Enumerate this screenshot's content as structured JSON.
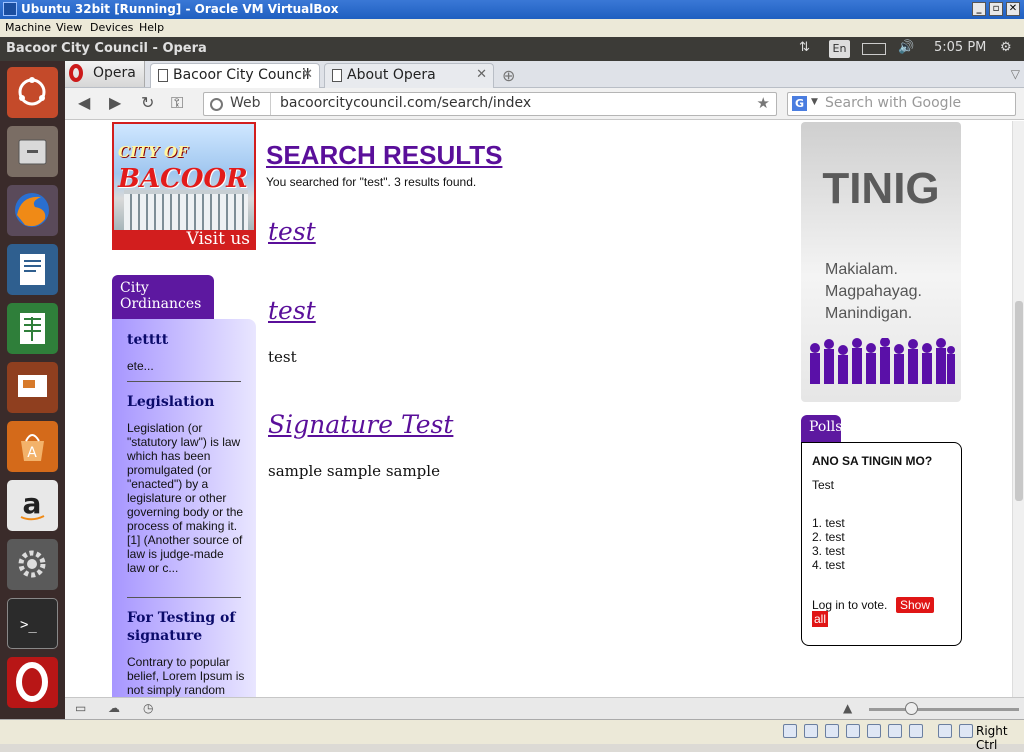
{
  "vbox": {
    "title": "Ubuntu 32bit [Running] - Oracle VM VirtualBox",
    "menu": [
      "Machine",
      "View",
      "Devices",
      "Help"
    ],
    "host_key": "Right Ctrl"
  },
  "ubuntu_panel": {
    "window_title": "Bacoor City Council - Opera",
    "keyboard_layout": "En",
    "clock": "5:05 PM"
  },
  "launcher": {
    "items": [
      "dash-home",
      "files",
      "firefox",
      "writer",
      "calc",
      "impress",
      "software-center",
      "amazon",
      "system-settings",
      "terminal",
      "opera"
    ]
  },
  "browser": {
    "menu_label": "Opera",
    "tabs": [
      {
        "label": "Bacoor City Council",
        "active": true
      },
      {
        "label": "About Opera",
        "active": false
      }
    ],
    "address": {
      "scheme_label": "Web",
      "url": "bacoorcitycouncil.com/search/index"
    },
    "search": {
      "engine": "G",
      "placeholder": "Search with Google"
    }
  },
  "page": {
    "logo": {
      "line1": "CITY OF",
      "line2": "BACOOR",
      "visit": "Visit us"
    },
    "ordinances": {
      "tab_label": "City Ordinances",
      "items": [
        {
          "title": "tetttt",
          "text": "ete..."
        },
        {
          "title": "Legislation",
          "text": "Legislation (or \"statutory law\") is law which has been promulgated (or \"enacted\") by a legislature or other governing body or the process of making it.[1] (Another source of law is judge-made law or c..."
        },
        {
          "title": "For Testing of signature",
          "text": "Contrary to popular belief, Lorem Ipsum is not simply random"
        }
      ]
    },
    "search_results": {
      "title": "SEARCH RESULTS",
      "summary": "You searched for \"test\". 3 results found.",
      "results": [
        {
          "title": "test",
          "body": ""
        },
        {
          "title": "test",
          "body": "test"
        },
        {
          "title": "Signature Test",
          "body": "sample sample sample"
        }
      ]
    },
    "tinig": {
      "title": "TINIG",
      "lines": [
        "Makialam.",
        "Magpahayag.",
        "Manindigan."
      ]
    },
    "polls": {
      "tab_label": "Polls",
      "question": "ANO SA TINGIN MO?",
      "description": "Test",
      "options": [
        "1. test",
        "2. test",
        "3. test",
        "4. test"
      ],
      "login_text": "Log in to vote.",
      "show_all_label_1": "Show",
      "show_all_label_2": "all"
    }
  },
  "colors": {
    "link_purple": "#5a0f9a",
    "brand_red": "#d21e1e",
    "panel_purple": "#5d18a0"
  }
}
